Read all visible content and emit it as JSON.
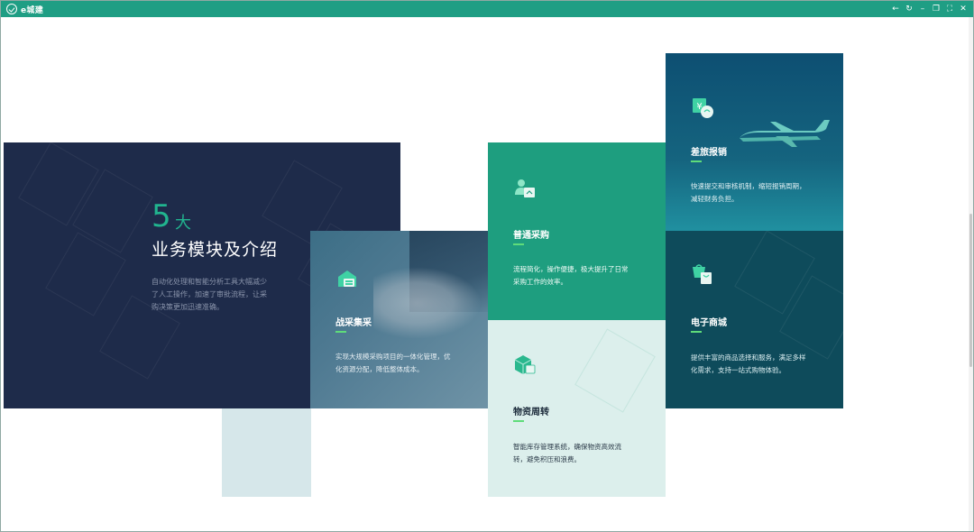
{
  "app": {
    "title": "e城建"
  },
  "window_controls": [
    "back",
    "refresh",
    "minimize",
    "restore",
    "fullscreen",
    "close"
  ],
  "hero": {
    "number": "5",
    "unit": "大",
    "title": "业务模块及介绍",
    "description": "自动化处理和智能分析工具大幅减少了人工操作，加速了审批流程，让采购决策更加迅速准确。"
  },
  "cards": {
    "zhancai": {
      "title": "战采集采",
      "description": "实现大规模采购项目的一体化管理，优化资源分配，降低整体成本。",
      "icon": "warehouse-icon"
    },
    "putong": {
      "title": "普通采购",
      "description": "流程简化，操作便捷，极大提升了日常采购工作的效率。",
      "icon": "person-box-icon"
    },
    "wuzi": {
      "title": "物资周转",
      "description": "智能库存管理系统，确保物资高效流转，避免积压和浪费。",
      "icon": "package-icon"
    },
    "chalv": {
      "title": "差旅报销",
      "description": "快速提交和审核机制，缩短报销周期，减轻财务负担。",
      "icon": "yen-coin-icon"
    },
    "dianzi": {
      "title": "电子商城",
      "description": "提供丰富的商品选择和服务，满足多样化需求，支持一站式购物体验。",
      "icon": "shop-bag-icon"
    }
  },
  "colors": {
    "titlebar": "#1f9e84",
    "hero_bg": "#1e2b4a",
    "accent_green": "#21b48f",
    "underline": "#5fdc7a"
  }
}
